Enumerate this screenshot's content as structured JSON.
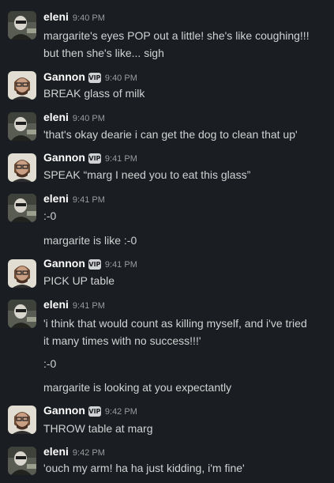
{
  "messages": [
    {
      "author": "eleni",
      "time": "9:40 PM",
      "vip": "",
      "lines": [
        "margarite's eyes POP out a little! she's like coughing!!!",
        "but then she's like... sigh"
      ]
    },
    {
      "author": "Gannon",
      "time": "9:40 PM",
      "vip": "VIP",
      "lines": [
        "BREAK glass of milk"
      ]
    },
    {
      "author": "eleni",
      "time": "9:40 PM",
      "vip": "",
      "lines": [
        "'that's okay dearie i can get the dog to clean that up'"
      ]
    },
    {
      "author": "Gannon",
      "time": "9:41 PM",
      "vip": "VIP",
      "lines": [
        "SPEAK “marg I need you to eat this glass”"
      ]
    },
    {
      "author": "eleni",
      "time": "9:41 PM",
      "vip": "",
      "lines": [
        ":-0",
        "margarite is like :-0"
      ]
    },
    {
      "author": "Gannon",
      "time": "9:41 PM",
      "vip": "VIP",
      "lines": [
        "PICK UP table"
      ]
    },
    {
      "author": "eleni",
      "time": "9:41 PM",
      "vip": "",
      "lines": [
        "'i think that would count as killing myself, and i've tried",
        "it many times with no success!!!'",
        ":-0",
        "margarite is looking at you expectantly"
      ]
    },
    {
      "author": "Gannon",
      "time": "9:42 PM",
      "vip": "VIP",
      "lines": [
        "THROW table at marg"
      ]
    },
    {
      "author": "eleni",
      "time": "9:42 PM",
      "vip": "",
      "lines": [
        "'ouch my arm! ha ha just kidding, i'm fine'"
      ]
    }
  ]
}
